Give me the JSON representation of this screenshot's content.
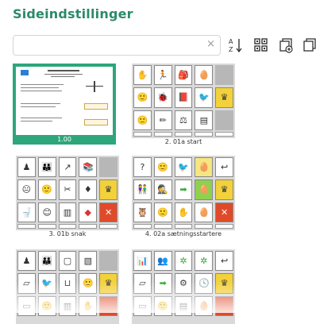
{
  "page": {
    "title": "Sideindstillinger"
  },
  "search": {
    "value": "",
    "placeholder": "",
    "clear_glyph": "×"
  },
  "toolbar": [
    {
      "name": "sort-az-icon"
    },
    {
      "name": "grid-view-icon"
    },
    {
      "name": "add-page-icon"
    },
    {
      "name": "copy-page-icon"
    }
  ],
  "pages": [
    {
      "label": "1.00",
      "selected": true
    },
    {
      "label": "2. 01a start",
      "selected": false
    },
    {
      "label": "3. 01b snak",
      "selected": false
    },
    {
      "label": "4. 02a sætningsstartere",
      "selected": false
    },
    {
      "label": "",
      "selected": false
    },
    {
      "label": "",
      "selected": false
    }
  ],
  "colors": {
    "accent": "#2da67a",
    "title": "#2b8a6a",
    "thumb_bg": "#d9d9d9"
  }
}
